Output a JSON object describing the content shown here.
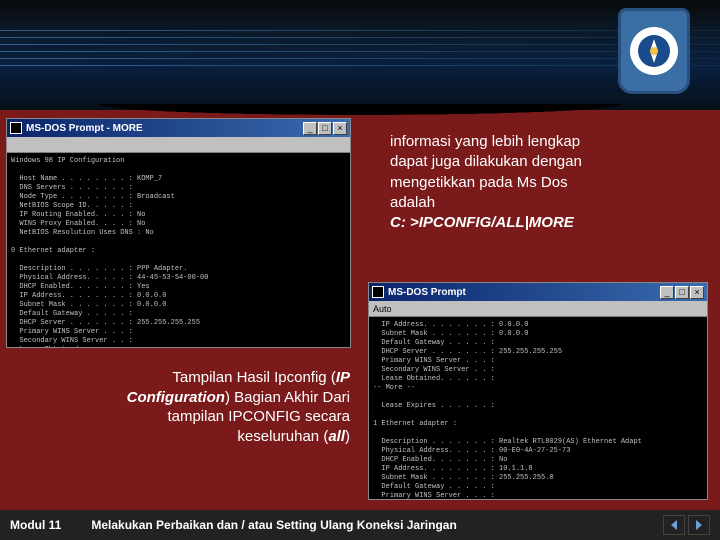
{
  "header": {
    "logo_name": "tut-wuri-handayani-logo"
  },
  "dos1": {
    "title": "MS-DOS Prompt - MORE",
    "content": "Windows 98 IP Configuration\n\n  Host Name . . . . . . . . : KOMP_7\n  DNS Servers . . . . . . . :\n  Node Type . . . . . . . . : Broadcast\n  NetBIOS Scope ID. . . . . :\n  IP Routing Enabled. . . . : No\n  WINS Proxy Enabled. . . . : No\n  NetBIOS Resolution Uses DNS : No\n\n0 Ethernet adapter :\n\n  Description . . . . . . . : PPP Adapter.\n  Physical Address. . . . . : 44-45-53-54-00-00\n  DHCP Enabled. . . . . . . : Yes\n  IP Address. . . . . . . . : 0.0.0.0\n  Subnet Mask . . . . . . . : 0.0.0.0\n  Default Gateway . . . . . :\n  DHCP Server . . . . . . . : 255.255.255.255\n  Primary WINS Server . . . :\n  Secondary WINS Server . . :\n  Lease Obtained. . . . . . :\n-- More --"
  },
  "dos2": {
    "title": "MS-DOS Prompt",
    "toolbar_label": "Auto",
    "content": "  IP Address. . . . . . . . : 0.0.0.0\n  Subnet Mask . . . . . . . : 0.0.0.0\n  Default Gateway . . . . . :\n  DHCP Server . . . . . . . : 255.255.255.255\n  Primary WINS Server . . . :\n  Secondary WINS Server . . :\n  Lease Obtained. . . . . . :\n-- More --\n\n  Lease Expires . . . . . . :\n\n1 Ethernet adapter :\n\n  Description . . . . . . . : Realtek RTL8029(AS) Ethernet Adapt\n  Physical Address. . . . . : 00-E0-4A-27-25-73\n  DHCP Enabled. . . . . . . : No\n  IP Address. . . . . . . . : 10.1.1.8\n  Subnet Mask . . . . . . . : 255.255.255.0\n  Default Gateway . . . . . :\n  Primary WINS Server . . . :\n  Secondary WINS Server . . :\n  Lease Obtained. . . . . . :\n  Lease Expires . . . . . . :\n\nC:\\>_"
  },
  "right_text": {
    "line1": "informasi yang lebih lengkap",
    "line2": "dapat juga dilakukan dengan",
    "line3": "mengetikkan pada Ms Dos",
    "line4": "adalah",
    "cmd": "C: >IPCONFIG/ALL|MORE"
  },
  "caption": {
    "part1": "Tampilan Hasil Ipconfig (",
    "ip": "IP",
    "part2": "Configuration",
    "part3": ") Bagian Akhir Dari",
    "part4": "tampilan IPCONFIG secara",
    "part5": "keseluruhan (",
    "all": "all",
    "part6": ")"
  },
  "footer": {
    "module": "Modul 11",
    "title": "Melakukan Perbaikan dan / atau Setting Ulang Koneksi Jaringan"
  }
}
